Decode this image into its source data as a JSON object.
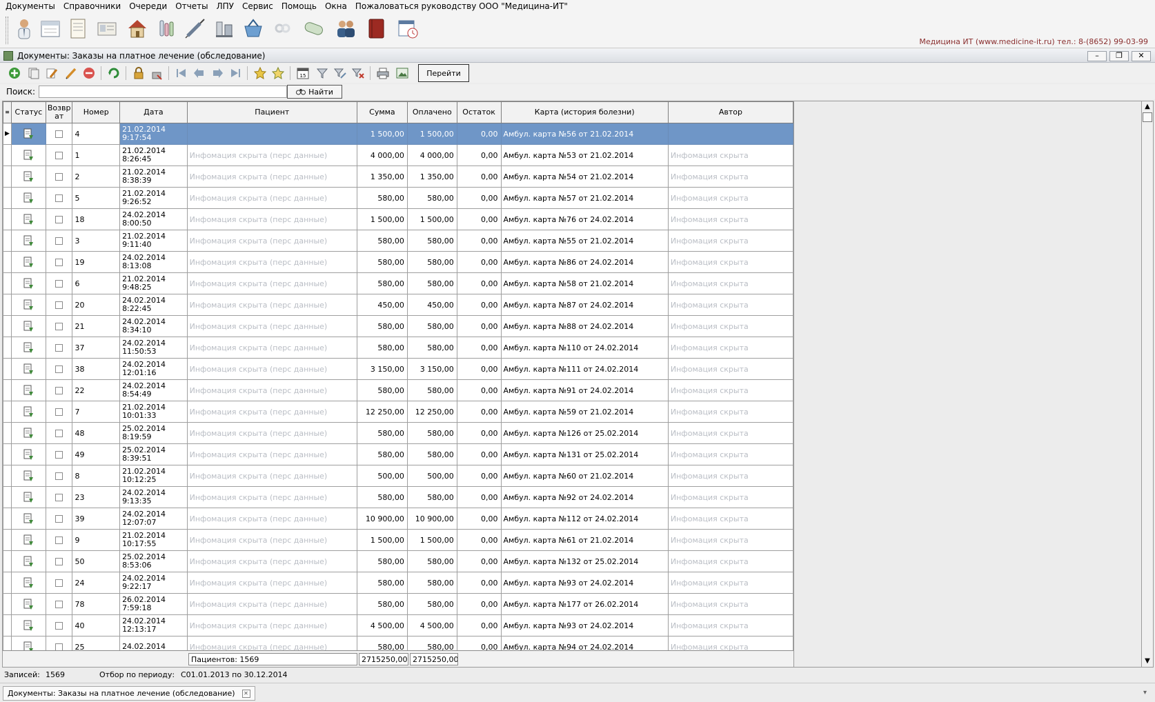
{
  "menu": [
    "Документы",
    "Справочники",
    "Очереди",
    "Отчеты",
    "ЛПУ",
    "Сервис",
    "Помощь",
    "Окна",
    "Пожаловаться руководству ООО \"Медицина-ИТ\""
  ],
  "contact": "Медицина ИТ (www.medicine-it.ru) тел.: 8-(8652) 99-03-99",
  "window": {
    "title": "Документы: Заказы на платное лечение (обследование)"
  },
  "toolbar": {
    "goto_label": "Перейти"
  },
  "search": {
    "label": "Поиск:",
    "value": "",
    "find_label": "Найти"
  },
  "columns": {
    "status": "Статус",
    "returned": "Возвр ат",
    "number": "Номер",
    "date": "Дата",
    "patient": "Пациент",
    "sum": "Сумма",
    "paid": "Оплачено",
    "balance": "Остаток",
    "card": "Карта (история болезни)",
    "author": "Автор"
  },
  "rows": [
    {
      "num": "4",
      "date": "21.02.2014",
      "time": "9:17:54",
      "patient": "",
      "sum": "1 500,00",
      "paid": "1 500,00",
      "bal": "0,00",
      "card": "Амбул. карта №56 от 21.02.2014",
      "author": ""
    },
    {
      "num": "1",
      "date": "21.02.2014",
      "time": "8:26:45",
      "patient": "Инфомация скрыта (перс данные)",
      "sum": "4 000,00",
      "paid": "4 000,00",
      "bal": "0,00",
      "card": "Амбул. карта №53 от 21.02.2014",
      "author": "Инфомация скрыта"
    },
    {
      "num": "2",
      "date": "21.02.2014",
      "time": "8:38:39",
      "patient": "Инфомация скрыта (перс данные)",
      "sum": "1 350,00",
      "paid": "1 350,00",
      "bal": "0,00",
      "card": "Амбул. карта №54 от 21.02.2014",
      "author": "Инфомация скрыта"
    },
    {
      "num": "5",
      "date": "21.02.2014",
      "time": "9:26:52",
      "patient": "Инфомация скрыта (перс данные)",
      "sum": "580,00",
      "paid": "580,00",
      "bal": "0,00",
      "card": "Амбул. карта №57 от 21.02.2014",
      "author": "Инфомация скрыта"
    },
    {
      "num": "18",
      "date": "24.02.2014",
      "time": "8:00:50",
      "patient": "Инфомация скрыта (перс данные)",
      "sum": "1 500,00",
      "paid": "1 500,00",
      "bal": "0,00",
      "card": "Амбул. карта №76 от 24.02.2014",
      "author": "Инфомация скрыта"
    },
    {
      "num": "3",
      "date": "21.02.2014",
      "time": "9:11:40",
      "patient": "Инфомация скрыта (перс данные)",
      "sum": "580,00",
      "paid": "580,00",
      "bal": "0,00",
      "card": "Амбул. карта №55 от 21.02.2014",
      "author": "Инфомация скрыта"
    },
    {
      "num": "19",
      "date": "24.02.2014",
      "time": "8:13:08",
      "patient": "Инфомация скрыта (перс данные)",
      "sum": "580,00",
      "paid": "580,00",
      "bal": "0,00",
      "card": "Амбул. карта №86 от 24.02.2014",
      "author": "Инфомация скрыта"
    },
    {
      "num": "6",
      "date": "21.02.2014",
      "time": "9:48:25",
      "patient": "Инфомация скрыта (перс данные)",
      "sum": "580,00",
      "paid": "580,00",
      "bal": "0,00",
      "card": "Амбул. карта №58 от 21.02.2014",
      "author": "Инфомация скрыта"
    },
    {
      "num": "20",
      "date": "24.02.2014",
      "time": "8:22:45",
      "patient": "Инфомация скрыта (перс данные)",
      "sum": "450,00",
      "paid": "450,00",
      "bal": "0,00",
      "card": "Амбул. карта №87 от 24.02.2014",
      "author": "Инфомация скрыта"
    },
    {
      "num": "21",
      "date": "24.02.2014",
      "time": "8:34:10",
      "patient": "Инфомация скрыта (перс данные)",
      "sum": "580,00",
      "paid": "580,00",
      "bal": "0,00",
      "card": "Амбул. карта №88 от 24.02.2014",
      "author": "Инфомация скрыта"
    },
    {
      "num": "37",
      "date": "24.02.2014",
      "time": "11:50:53",
      "patient": "Инфомация скрыта (перс данные)",
      "sum": "580,00",
      "paid": "580,00",
      "bal": "0,00",
      "card": "Амбул. карта №110 от 24.02.2014",
      "author": "Инфомация скрыта"
    },
    {
      "num": "38",
      "date": "24.02.2014",
      "time": "12:01:16",
      "patient": "Инфомация скрыта (перс данные)",
      "sum": "3 150,00",
      "paid": "3 150,00",
      "bal": "0,00",
      "card": "Амбул. карта №111 от 24.02.2014",
      "author": "Инфомация скрыта"
    },
    {
      "num": "22",
      "date": "24.02.2014",
      "time": "8:54:49",
      "patient": "Инфомация скрыта (перс данные)",
      "sum": "580,00",
      "paid": "580,00",
      "bal": "0,00",
      "card": "Амбул. карта №91 от 24.02.2014",
      "author": "Инфомация скрыта"
    },
    {
      "num": "7",
      "date": "21.02.2014",
      "time": "10:01:33",
      "patient": "Инфомация скрыта (перс данные)",
      "sum": "12 250,00",
      "paid": "12 250,00",
      "bal": "0,00",
      "card": "Амбул. карта №59 от 21.02.2014",
      "author": "Инфомация скрыта"
    },
    {
      "num": "48",
      "date": "25.02.2014",
      "time": "8:19:59",
      "patient": "Инфомация скрыта (перс данные)",
      "sum": "580,00",
      "paid": "580,00",
      "bal": "0,00",
      "card": "Амбул. карта №126 от 25.02.2014",
      "author": "Инфомация скрыта"
    },
    {
      "num": "49",
      "date": "25.02.2014",
      "time": "8:39:51",
      "patient": "Инфомация скрыта (перс данные)",
      "sum": "580,00",
      "paid": "580,00",
      "bal": "0,00",
      "card": "Амбул. карта №131 от 25.02.2014",
      "author": "Инфомация скрыта"
    },
    {
      "num": "8",
      "date": "21.02.2014",
      "time": "10:12:25",
      "patient": "Инфомация скрыта (перс данные)",
      "sum": "500,00",
      "paid": "500,00",
      "bal": "0,00",
      "card": "Амбул. карта №60 от 21.02.2014",
      "author": "Инфомация скрыта"
    },
    {
      "num": "23",
      "date": "24.02.2014",
      "time": "9:13:35",
      "patient": "Инфомация скрыта (перс данные)",
      "sum": "580,00",
      "paid": "580,00",
      "bal": "0,00",
      "card": "Амбул. карта №92 от 24.02.2014",
      "author": "Инфомация скрыта"
    },
    {
      "num": "39",
      "date": "24.02.2014",
      "time": "12:07:07",
      "patient": "Инфомация скрыта (перс данные)",
      "sum": "10 900,00",
      "paid": "10 900,00",
      "bal": "0,00",
      "card": "Амбул. карта №112 от 24.02.2014",
      "author": "Инфомация скрыта"
    },
    {
      "num": "9",
      "date": "21.02.2014",
      "time": "10:17:55",
      "patient": "Инфомация скрыта (перс данные)",
      "sum": "1 500,00",
      "paid": "1 500,00",
      "bal": "0,00",
      "card": "Амбул. карта №61 от 21.02.2014",
      "author": "Инфомация скрыта"
    },
    {
      "num": "50",
      "date": "25.02.2014",
      "time": "8:53:06",
      "patient": "Инфомация скрыта (перс данные)",
      "sum": "580,00",
      "paid": "580,00",
      "bal": "0,00",
      "card": "Амбул. карта №132 от 25.02.2014",
      "author": "Инфомация скрыта"
    },
    {
      "num": "24",
      "date": "24.02.2014",
      "time": "9:22:17",
      "patient": "Инфомация скрыта (перс данные)",
      "sum": "580,00",
      "paid": "580,00",
      "bal": "0,00",
      "card": "Амбул. карта №93 от 24.02.2014",
      "author": "Инфомация скрыта"
    },
    {
      "num": "78",
      "date": "26.02.2014",
      "time": "7:59:18",
      "patient": "Инфомация скрыта (перс данные)",
      "sum": "580,00",
      "paid": "580,00",
      "bal": "0,00",
      "card": "Амбул. карта №177 от 26.02.2014",
      "author": "Инфомация скрыта"
    },
    {
      "num": "40",
      "date": "24.02.2014",
      "time": "12:13:17",
      "patient": "Инфомация скрыта (перс данные)",
      "sum": "4 500,00",
      "paid": "4 500,00",
      "bal": "0,00",
      "card": "Амбул. карта №93 от 24.02.2014",
      "author": "Инфомация скрыта"
    },
    {
      "num": "25",
      "date": "24.02.2014",
      "time": "",
      "patient": "Инфомация скрыта (перс данные)",
      "sum": "580,00",
      "paid": "580,00",
      "bal": "0,00",
      "card": "Амбул. карта №94 от 24.02.2014",
      "author": "Инфомация скрыта"
    }
  ],
  "footer": {
    "patients": "Пациентов: 1569",
    "sum_total": "2715250,00 р",
    "paid_total": "2715250,00 р"
  },
  "status": {
    "records_label": "Записей:",
    "records_value": "1569",
    "period_label": "Отбор по периоду:",
    "period_value": "С01.01.2013 по 30.12.2014"
  },
  "tabs": [
    "Документы: Заказы на платное лечение (обследование)"
  ],
  "colors": {
    "selected_row": "#6f96c7",
    "hidden_text": "#b9bdc4",
    "contact_text": "#8a2f2f"
  }
}
